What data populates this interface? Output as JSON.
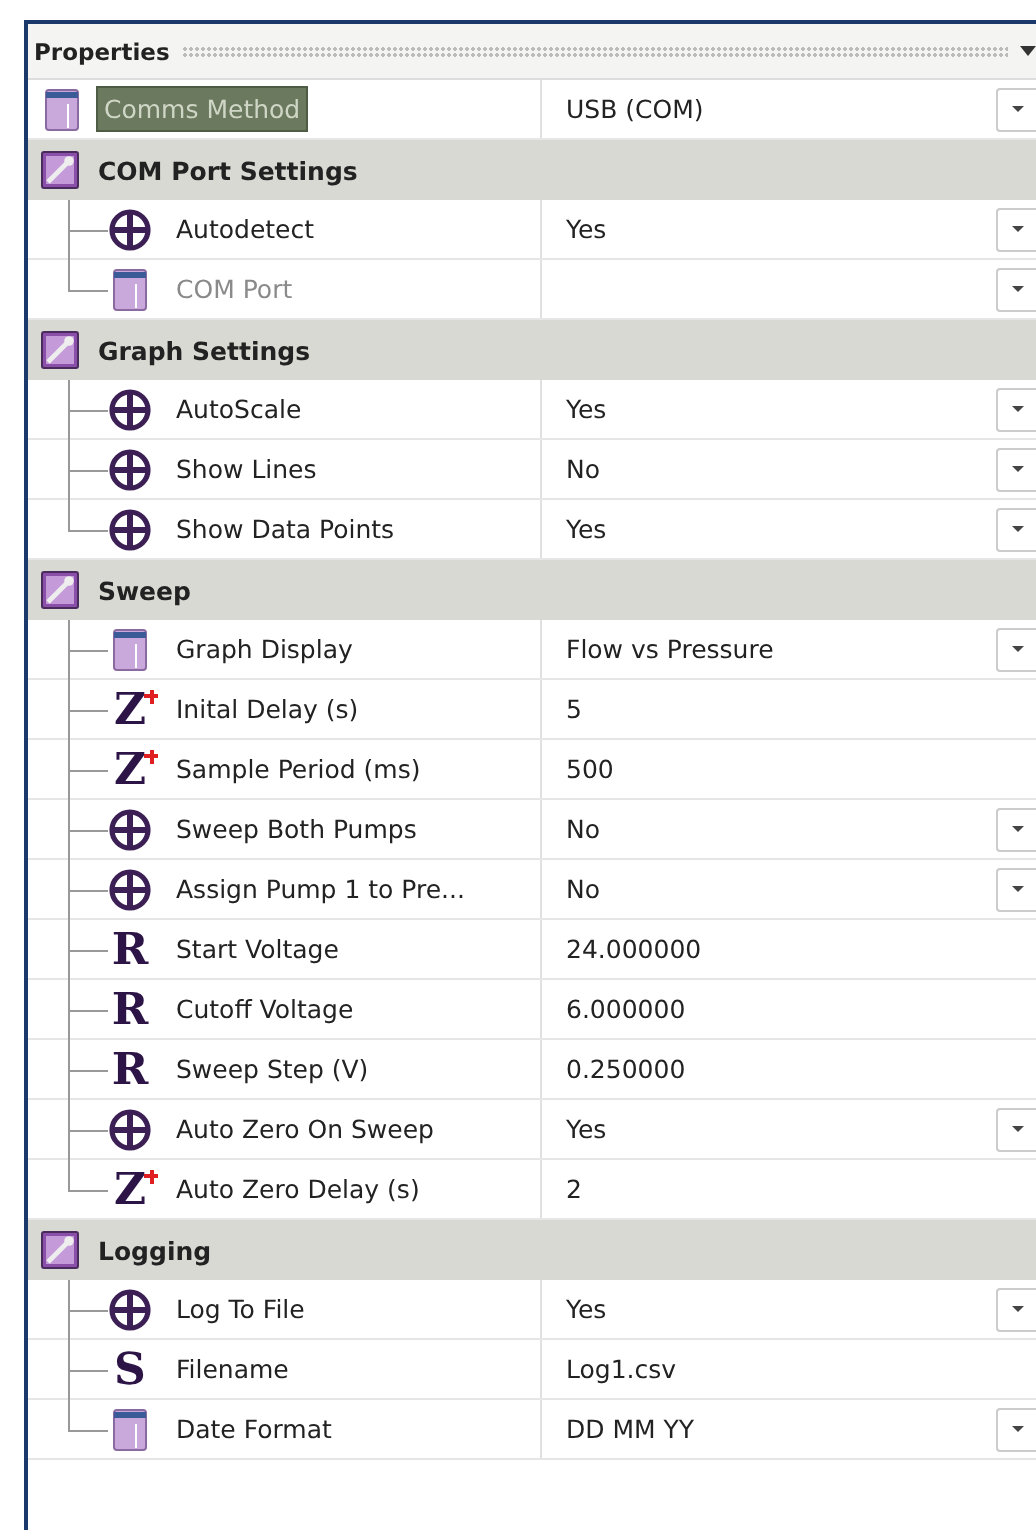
{
  "panel": {
    "title": "Properties"
  },
  "items": [
    {
      "kind": "list",
      "label": "Comms Method",
      "value": "USB (COM)",
      "dropdown": true,
      "selected": true,
      "disabled": false
    },
    {
      "kind": "group",
      "label": "COM Port Settings",
      "children": [
        {
          "kind": "bool",
          "label": "Autodetect",
          "value": "Yes",
          "dropdown": true,
          "selected": false,
          "disabled": false
        },
        {
          "kind": "list",
          "label": "COM Port",
          "dropdown": true,
          "selected": false,
          "disabled": true
        }
      ]
    },
    {
      "kind": "group",
      "label": "Graph Settings",
      "children": [
        {
          "kind": "bool",
          "label": "AutoScale",
          "value": "Yes",
          "dropdown": true,
          "selected": false,
          "disabled": false
        },
        {
          "kind": "bool",
          "label": "Show Lines",
          "value": "No",
          "dropdown": true,
          "selected": false,
          "disabled": false
        },
        {
          "kind": "bool",
          "label": "Show Data Points",
          "value": "Yes",
          "dropdown": true,
          "selected": false,
          "disabled": false
        }
      ]
    },
    {
      "kind": "group",
      "label": "Sweep",
      "children": [
        {
          "kind": "list",
          "label": "Graph Display",
          "value": "Flow vs Pressure",
          "dropdown": true,
          "selected": false,
          "disabled": false
        },
        {
          "kind": "glyph",
          "glyph": "Z",
          "starred": true,
          "label": "Inital Delay (s)",
          "value": "5",
          "dropdown": false,
          "selected": false,
          "disabled": false
        },
        {
          "kind": "glyph",
          "glyph": "Z",
          "starred": true,
          "label": "Sample Period (ms)",
          "value": "500",
          "dropdown": false,
          "selected": false,
          "disabled": false
        },
        {
          "kind": "bool",
          "label": "Sweep Both Pumps",
          "value": "No",
          "dropdown": true,
          "selected": false,
          "disabled": false
        },
        {
          "kind": "bool",
          "label": "Assign Pump 1 to Pre...",
          "value": "No",
          "dropdown": true,
          "selected": false,
          "disabled": false
        },
        {
          "kind": "glyph",
          "glyph": "R",
          "starred": false,
          "label": "Start Voltage",
          "value": "24.000000",
          "dropdown": false,
          "selected": false,
          "disabled": false
        },
        {
          "kind": "glyph",
          "glyph": "R",
          "starred": false,
          "label": "Cutoff Voltage",
          "value": "6.000000",
          "dropdown": false,
          "selected": false,
          "disabled": false
        },
        {
          "kind": "glyph",
          "glyph": "R",
          "starred": false,
          "label": "Sweep Step (V)",
          "value": "0.250000",
          "dropdown": false,
          "selected": false,
          "disabled": false
        },
        {
          "kind": "bool",
          "label": "Auto Zero On Sweep",
          "value": "Yes",
          "dropdown": true,
          "selected": false,
          "disabled": false
        },
        {
          "kind": "glyph",
          "glyph": "Z",
          "starred": true,
          "label": "Auto Zero Delay (s)",
          "value": "2",
          "dropdown": false,
          "selected": false,
          "disabled": false
        }
      ]
    },
    {
      "kind": "group",
      "label": "Logging",
      "children": [
        {
          "kind": "bool",
          "label": "Log To File",
          "value": "Yes",
          "dropdown": true,
          "selected": false,
          "disabled": false
        },
        {
          "kind": "glyph",
          "glyph": "S",
          "starred": false,
          "label": "Filename",
          "value": "Log1.csv",
          "dropdown": false,
          "selected": false,
          "disabled": false
        },
        {
          "kind": "list",
          "label": "Date Format",
          "value": "DD MM YY",
          "dropdown": true,
          "selected": false,
          "disabled": false
        }
      ]
    }
  ]
}
